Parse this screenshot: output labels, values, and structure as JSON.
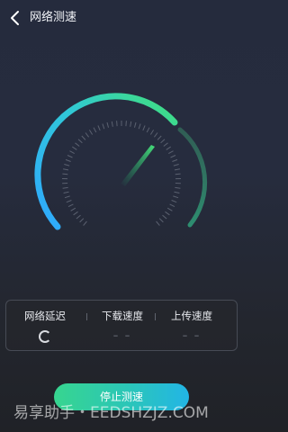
{
  "header": {
    "title": "网络测速",
    "back_icon": "chevron-left-icon"
  },
  "gauge": {
    "needle_icon": "speed-needle-icon",
    "colors": {
      "start": "#2fa8ff",
      "mid": "#36d68b",
      "end": "#3a8f6b",
      "ticks": "#5b6170"
    }
  },
  "metrics": [
    {
      "label": "网络延迟",
      "value": ""
    },
    {
      "label": "下载速度",
      "value": "– –"
    },
    {
      "label": "上传速度",
      "value": "– –"
    }
  ],
  "loading_icon": "spinner-icon",
  "stop_button": {
    "label": "停止测速"
  },
  "watermark": {
    "text": "易享助手・EEDSHZJZ.COM"
  }
}
